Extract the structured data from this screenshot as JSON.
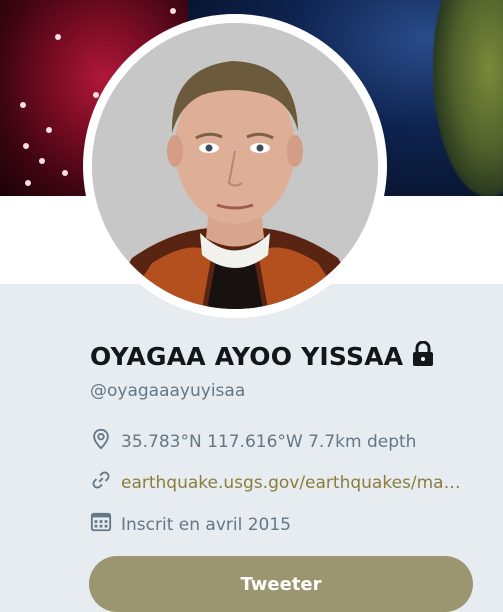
{
  "profile": {
    "name": "OYAGAA AYOO YISSAA",
    "handle": "@oyagaaayuyisaa",
    "location": "35.783°N 117.616°W 7.7km depth",
    "website": "earthquake.usgs.gov/earthquakes/ma…",
    "joined": "Inscrit en avril 2015",
    "protected": true
  },
  "actions": {
    "tweet_label": "Tweeter"
  },
  "icons": {
    "location": "map-pin-icon",
    "website": "link-icon",
    "joined": "calendar-icon",
    "protected": "lock-icon"
  },
  "colors": {
    "link": "#8a7d3c",
    "button": "#9c9670",
    "secondary_text": "#657786",
    "background": "#e6ecf0"
  }
}
